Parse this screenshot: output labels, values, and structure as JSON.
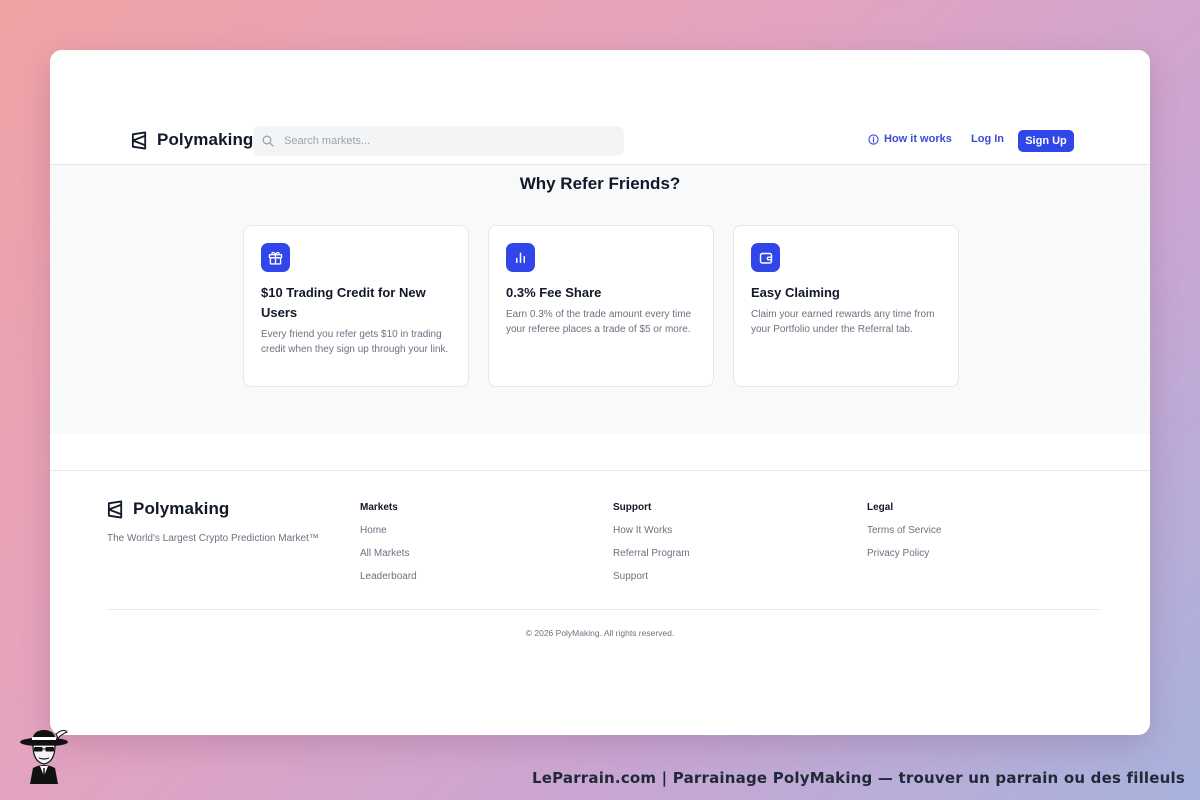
{
  "header": {
    "brand": "Polymaking",
    "search_placeholder": "Search markets...",
    "how_it_works": "How it works",
    "log_in": "Log In",
    "sign_up": "Sign Up"
  },
  "section": {
    "title": "Why Refer Friends?",
    "cards": [
      {
        "icon": "gift-icon",
        "title": "$10 Trading Credit for New Users",
        "description": "Every friend you refer gets $10 in trading credit when they sign up through your link."
      },
      {
        "icon": "bar-chart-icon",
        "title": "0.3% Fee Share",
        "description": "Earn 0.3% of the trade amount every time your referee places a trade of $5 or more."
      },
      {
        "icon": "wallet-icon",
        "title": "Easy Claiming",
        "description": "Claim your earned rewards any time from your Portfolio under the Referral tab."
      }
    ]
  },
  "footer": {
    "brand": "Polymaking",
    "tagline": "The World's Largest Crypto Prediction Market™",
    "columns": [
      {
        "heading": "Markets",
        "links": [
          "Home",
          "All Markets",
          "Leaderboard"
        ]
      },
      {
        "heading": "Support",
        "links": [
          "How It Works",
          "Referral Program",
          "Support"
        ]
      },
      {
        "heading": "Legal",
        "links": [
          "Terms of Service",
          "Privacy Policy"
        ]
      }
    ],
    "copyright": "© 2026 PolyMaking. All rights reserved."
  },
  "overlay": {
    "watermark": "LeParrain.com | Parrainage PolyMaking — trouver un parrain ou des filleuls"
  },
  "colors": {
    "accent": "#3146e8",
    "link": "#3b4bd9"
  }
}
